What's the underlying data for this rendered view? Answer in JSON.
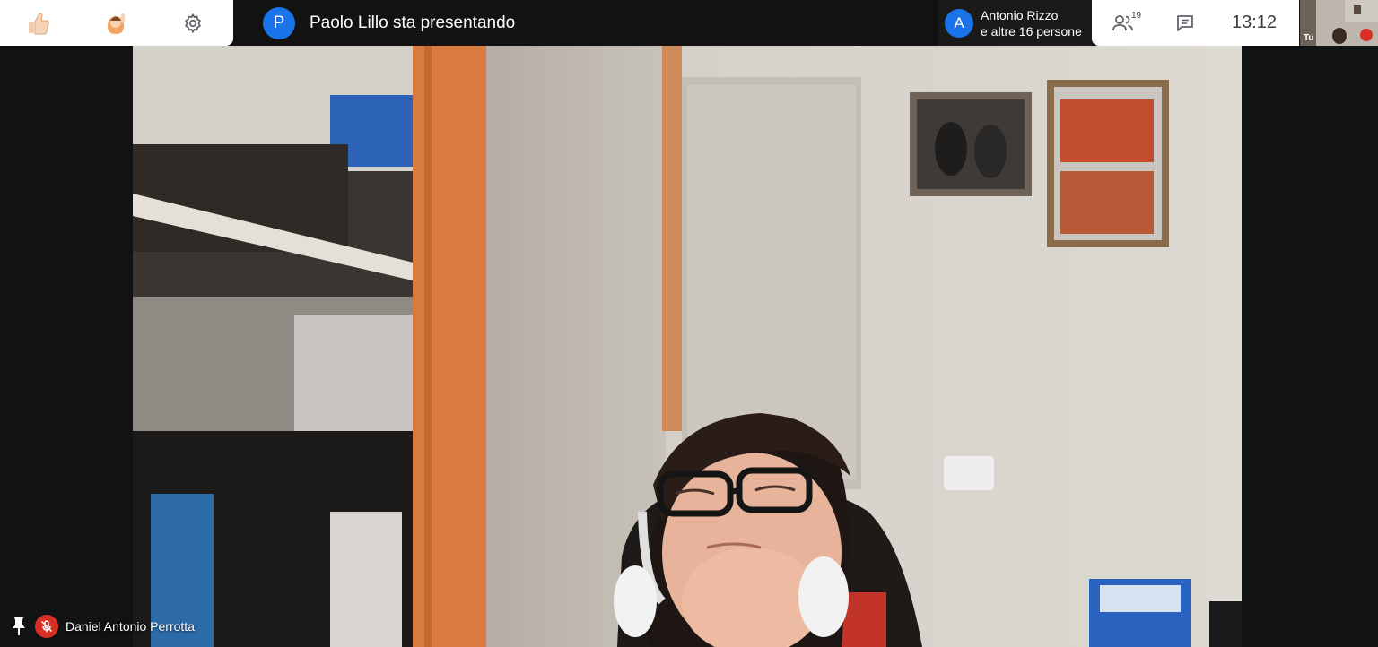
{
  "toolbar": {
    "thumbs_icon": "thumbs-up-icon",
    "raise_hand_icon": "raise-hand-icon",
    "settings_icon": "gear-icon"
  },
  "presenter": {
    "initial": "P",
    "text": "Paolo Lillo sta presentando",
    "color": "#1a73e8"
  },
  "participants_chip": {
    "initial": "A",
    "line1": "Antonio Rizzo",
    "line2": "e altre 16 persone"
  },
  "participants": {
    "count": "19"
  },
  "clock": "13:12",
  "self_view": {
    "label": "Tu"
  },
  "main_tile": {
    "name": "Daniel Antonio Perrotta",
    "muted": true
  },
  "colors": {
    "mute_red": "#d93025",
    "accent_blue": "#1a73e8"
  }
}
